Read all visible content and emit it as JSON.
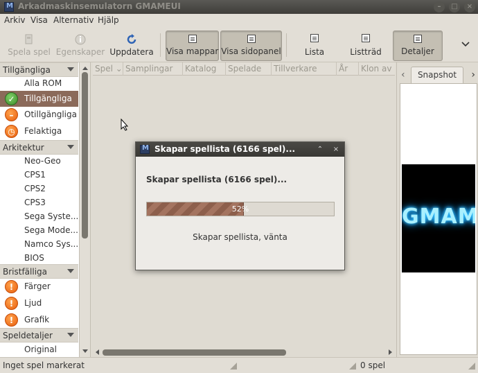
{
  "window": {
    "title": "Arkadmaskinsemulatorn GMAMEUI",
    "controls": [
      "minimize",
      "maximize",
      "close"
    ]
  },
  "menubar": {
    "items": [
      "Arkiv",
      "Visa",
      "Alternativ",
      "Hjälp"
    ]
  },
  "toolbar": {
    "buttons": [
      {
        "label": "Spela spel",
        "icon": "play-game-icon",
        "enabled": false
      },
      {
        "label": "Egenskaper",
        "icon": "info-icon",
        "enabled": false
      },
      {
        "label": "Uppdatera",
        "icon": "refresh-icon",
        "enabled": true
      },
      {
        "label": "Visa mappar",
        "icon": "folders-icon",
        "pressed": true
      },
      {
        "label": "Visa sidopanel",
        "icon": "sidepanel-icon",
        "pressed": true
      },
      {
        "label": "Lista",
        "icon": "list-icon"
      },
      {
        "label": "Listträd",
        "icon": "list-tree-icon"
      },
      {
        "label": "Detaljer",
        "icon": "details-icon",
        "pressed": true
      }
    ],
    "overflow_icon": "chevron-down-icon"
  },
  "sidebar": {
    "sections": [
      {
        "title": "Tillgängliga",
        "items": [
          {
            "label": "Alla ROM"
          },
          {
            "label": "Tillgängliga",
            "icon": "check-icon",
            "selected": true
          },
          {
            "label": "Otillgängliga",
            "icon": "unavailable-icon"
          },
          {
            "label": "Felaktiga",
            "icon": "clock-icon"
          }
        ]
      },
      {
        "title": "Arkitektur",
        "items": [
          {
            "label": "Neo-Geo"
          },
          {
            "label": "CPS1"
          },
          {
            "label": "CPS2"
          },
          {
            "label": "CPS3"
          },
          {
            "label": "Sega Syste..."
          },
          {
            "label": "Sega Mode..."
          },
          {
            "label": "Namco Sys..."
          },
          {
            "label": "BIOS"
          }
        ]
      },
      {
        "title": "Bristfälliga",
        "items": [
          {
            "label": "Färger",
            "icon": "warning-icon"
          },
          {
            "label": "Ljud",
            "icon": "warning-icon"
          },
          {
            "label": "Grafik",
            "icon": "warning-icon"
          }
        ]
      },
      {
        "title": "Speldetaljer",
        "items": [
          {
            "label": "Original"
          }
        ]
      }
    ]
  },
  "gamelist": {
    "columns": [
      "Spel",
      "Samplingar",
      "Katalog",
      "Spelade",
      "Tillverkare",
      "År",
      "Klon av"
    ]
  },
  "sidepanel": {
    "tab": "Snapshot",
    "image_text": "GMAMEUI"
  },
  "statusbar": {
    "left": "Inget spel markerat",
    "right": "0 spel"
  },
  "dialog": {
    "title": "Skapar spellista (6166 spel)...",
    "heading": "Skapar spellista (6166 spel)...",
    "progress": 0.52,
    "progress_text": "52%",
    "message": "Skapar spellista, vänta"
  },
  "colors": {
    "selection": "#8b6a5a",
    "titlebar": "#3f3e3a",
    "warning": "#e85e0d",
    "ok": "#3c8b2b"
  }
}
